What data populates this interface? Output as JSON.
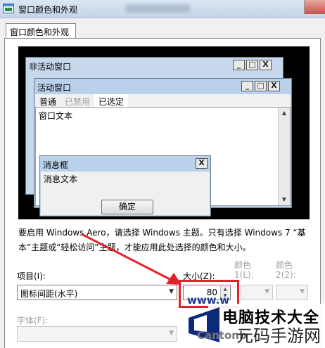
{
  "window": {
    "title": "窗口颜色和外观"
  },
  "tabs": [
    {
      "label": "窗口颜色和外观"
    }
  ],
  "preview": {
    "inactive_title": "非活动窗口",
    "active_title": "活动窗口",
    "menu": {
      "normal": "普通",
      "disabled": "已禁用",
      "selected": "已选定"
    },
    "window_text": "窗口文本",
    "message_box_title": "消息框",
    "message_text": "消息文本",
    "ok_label": "确定",
    "btn_min": "_",
    "btn_max": "□",
    "btn_close": "X"
  },
  "description": "要启用 Windows Aero，请选择 Windows 主题。只有选择 Windows 7 “基本”主题或“轻松访问”主题，才能应用此处选择的颜色和大小。",
  "item": {
    "label": "项目(I):",
    "value": "图标间距(水平)"
  },
  "size": {
    "label": "大小(Z):",
    "value": "80"
  },
  "color1": {
    "label_line1": "颜色",
    "label_line2": "1(L):"
  },
  "color2": {
    "label_line1": "颜色",
    "label_line2": "2(2):"
  },
  "font": {
    "label": "字体(F):"
  },
  "watermark": {
    "url": "www.w",
    "title": "电脑技术大全",
    "domain": "Cantonb",
    "bottom_text": "元码手游网"
  }
}
